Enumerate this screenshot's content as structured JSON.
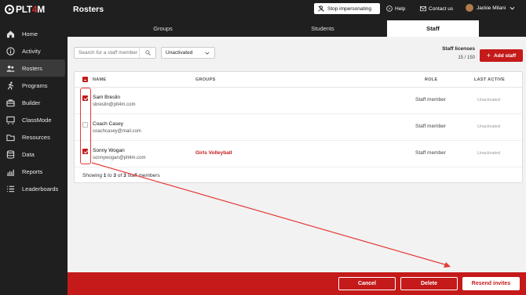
{
  "app": {
    "brand_left": "PLT",
    "brand_accent": "4",
    "brand_right": "M"
  },
  "header": {
    "title": "Rosters",
    "stop_impersonating": "Stop impersonating",
    "help": "Help",
    "contact": "Contact us",
    "user_name": "Jackie Milani"
  },
  "sidebar": {
    "items": [
      {
        "label": "Home",
        "icon": "home-icon"
      },
      {
        "label": "Activity",
        "icon": "info-icon"
      },
      {
        "label": "Rosters",
        "icon": "users-icon",
        "active": true
      },
      {
        "label": "Programs",
        "icon": "running-icon"
      },
      {
        "label": "Builder",
        "icon": "briefcase-icon"
      },
      {
        "label": "ClassMode",
        "icon": "classmode-icon"
      },
      {
        "label": "Resources",
        "icon": "folder-icon"
      },
      {
        "label": "Data",
        "icon": "database-icon"
      },
      {
        "label": "Reports",
        "icon": "chart-icon"
      },
      {
        "label": "Leaderboards",
        "icon": "list-icon"
      }
    ]
  },
  "tabs": [
    {
      "label": "Groups"
    },
    {
      "label": "Students"
    },
    {
      "label": "Staff",
      "active": true
    }
  ],
  "toolbar": {
    "search_placeholder": "Search for a staff member",
    "filter_value": "Unactivated",
    "licenses_label": "Staff licenses",
    "licenses_count": "15 / 150",
    "add_staff": "Add staff"
  },
  "table": {
    "columns": [
      "NAME",
      "GROUPS",
      "ROLE",
      "LAST ACTIVE"
    ],
    "rows": [
      {
        "name": "Sam Breslin",
        "email": "sbreslin@plt4m.com",
        "group": "",
        "role": "Staff member",
        "last_active": "Unactivated",
        "checked": true
      },
      {
        "name": "Coach Casey",
        "email": "coachcasey@mail.com",
        "group": "",
        "role": "Staff member",
        "last_active": "Unactivated",
        "checked": false
      },
      {
        "name": "Sonny Wogan",
        "email": "sonnywogan@plt4m.com",
        "group": "Girls Volleyball",
        "role": "Staff member",
        "last_active": "Unactivated",
        "checked": true
      }
    ],
    "showing_prefix": "Showing ",
    "showing_from": "1",
    "showing_to_word": " to ",
    "showing_to": "3",
    "showing_of_word": " of ",
    "showing_total": "3",
    "showing_suffix": " staff members"
  },
  "bottom_bar": {
    "cancel": "Cancel",
    "delete": "Delete",
    "resend": "Resend invites"
  },
  "colors": {
    "brand_red": "#c41a1a",
    "sidebar": "#1f1f1f",
    "annotation": "#e53935"
  }
}
